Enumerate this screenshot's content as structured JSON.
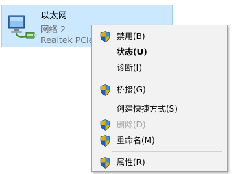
{
  "adapter": {
    "name": "以太网",
    "network": "网络 2",
    "device": "Realtek PCIe"
  },
  "menu": {
    "items": [
      {
        "label": "禁用(B)",
        "icon": "uac-shield-icon",
        "bold": false,
        "enabled": true
      },
      {
        "label": "状态(U)",
        "icon": "",
        "bold": true,
        "enabled": true
      },
      {
        "label": "诊断(I)",
        "icon": "",
        "bold": false,
        "enabled": true
      },
      {
        "label": "桥接(G)",
        "icon": "uac-shield-icon",
        "bold": false,
        "enabled": true
      },
      {
        "label": "创建快捷方式(S)",
        "icon": "",
        "bold": false,
        "enabled": true
      },
      {
        "label": "删除(D)",
        "icon": "uac-shield-icon",
        "bold": false,
        "enabled": false
      },
      {
        "label": "重命名(M)",
        "icon": "uac-shield-icon",
        "bold": false,
        "enabled": true
      },
      {
        "label": "属性(R)",
        "icon": "uac-shield-icon",
        "bold": false,
        "enabled": true
      }
    ]
  },
  "colors": {
    "selection_background": "#cce8ff",
    "selection_border": "#99d1ff",
    "menu_background": "#f2f2f2",
    "disabled_text": "#a0a0a0"
  }
}
